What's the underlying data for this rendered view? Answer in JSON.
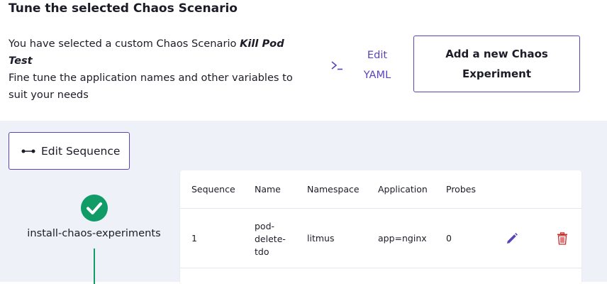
{
  "header": {
    "title": "Tune the selected Chaos Scenario",
    "desc_prefix": "You have selected a custom Chaos Scenario ",
    "scenario_name": "Kill Pod Test",
    "desc_line2": "Fine tune the application names and other variables to suit your needs"
  },
  "actions": {
    "edit_yaml_label": "Edit YAML",
    "edit_yaml_icon": "terminal-icon",
    "add_experiment_label": "Add a new Chaos Experiment"
  },
  "workflow": {
    "edit_sequence_label": "Edit Sequence",
    "edit_sequence_icon": "sequence-icon",
    "step_name": "install-chaos-experiments",
    "step_status_icon": "check-circle-icon"
  },
  "table": {
    "columns": [
      "Sequence",
      "Name",
      "Namespace",
      "Application",
      "Probes"
    ],
    "rows": [
      {
        "sequence": "1",
        "name_lines": [
          "pod-",
          "delete-",
          "tdo"
        ],
        "namespace": "litmus",
        "application": "app=nginx",
        "probes": "0"
      }
    ]
  },
  "colors": {
    "accent": "#5b44ba",
    "success": "#109b67",
    "danger": "#ca2c2c",
    "workspace_bg": "#eff1f9"
  }
}
